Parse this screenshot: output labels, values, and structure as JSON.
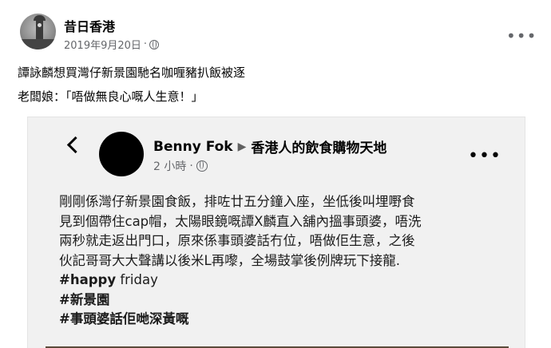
{
  "post": {
    "page_name": "昔日香港",
    "date": "2019年9月20日",
    "separator": "·",
    "line1": "譚詠麟想買灣仔新景園馳名咖喱豬扒飯被逐",
    "line2": "老闆娘：「唔做無良心嘅人生意！」"
  },
  "shared": {
    "author": "Benny Fok",
    "arrow": "▶",
    "group": "香港人的飲食購物天地",
    "time": "2 小時",
    "separator": "·",
    "body_lines": [
      "剛剛係灣仔新景園食飯，排咗廿五分鐘入座，坐低後叫埋嘢食",
      "見到個帶住cap帽，太陽眼鏡嘅譚X麟直入舖內搵事頭婆，唔洗",
      "兩秒就走返出門口，原來係事頭婆話冇位，唔做佢生意，之後",
      "伙記哥哥大大聲講以後米L再嚟，全場鼓掌後例牌玩下接龍."
    ],
    "hashtag1_bold": "#happy",
    "hashtag1_rest": " friday",
    "hashtag2": "#新景園",
    "hashtag3": "#事頭婆話佢哋深黃嘅"
  },
  "icons": {
    "more": "•••"
  }
}
